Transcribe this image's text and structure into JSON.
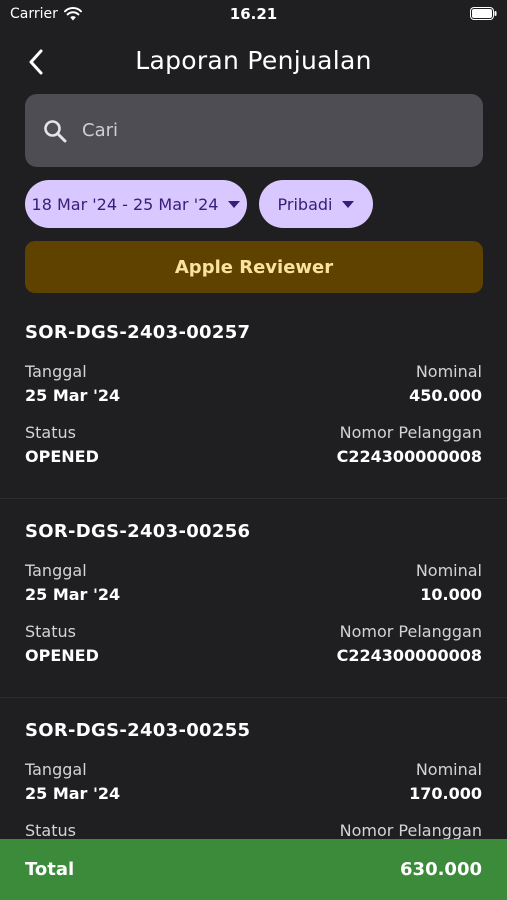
{
  "status_bar": {
    "carrier": "Carrier",
    "time": "16.21"
  },
  "header": {
    "title": "Laporan Penjualan",
    "back_icon": "chevron-left-icon"
  },
  "search": {
    "placeholder": "Cari",
    "value": ""
  },
  "filters": {
    "date_range": "18 Mar '24 - 25 Mar '24",
    "type": "Pribadi"
  },
  "reviewer_banner": {
    "label": "Apple Reviewer"
  },
  "labels": {
    "date": "Tanggal",
    "amount": "Nominal",
    "status": "Status",
    "customer_no": "Nomor Pelanggan"
  },
  "orders": [
    {
      "id": "SOR-DGS-2403-00257",
      "date": "25 Mar '24",
      "amount": "450.000",
      "status": "OPENED",
      "customer_no": "C224300000008"
    },
    {
      "id": "SOR-DGS-2403-00256",
      "date": "25 Mar '24",
      "amount": "10.000",
      "status": "OPENED",
      "customer_no": "C224300000008"
    },
    {
      "id": "SOR-DGS-2403-00255",
      "date": "25 Mar '24",
      "amount": "170.000",
      "status": "",
      "customer_no": ""
    }
  ],
  "total": {
    "label": "Total",
    "value": "630.000"
  },
  "colors": {
    "background": "#1f1f21",
    "search_bg": "#4e4d53",
    "chip_bg": "#d9c8ff",
    "chip_text": "#3a1c7a",
    "banner_bg": "#5f4200",
    "banner_text": "#fbe2a0",
    "total_bg": "#3c8b3a"
  }
}
